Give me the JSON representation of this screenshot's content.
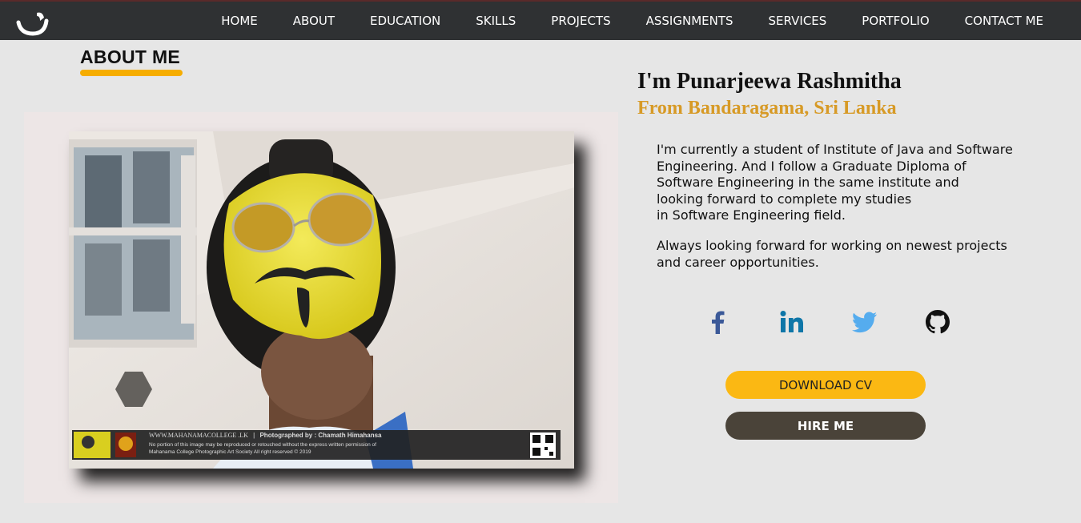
{
  "nav": {
    "items": [
      "HOME",
      "ABOUT",
      "EDUCATION",
      "SKILLS",
      "PROJECTS",
      "ASSIGNMENTS",
      "SERVICES",
      "PORTFOLIO",
      "CONTACT ME"
    ]
  },
  "about": {
    "section_title": "ABOUT ME",
    "name": "I'm Punarjeewa Rashmitha",
    "location": "From Bandaragama, Sri Lanka",
    "bio_paragraph_1_lines": [
      "I'm currently a student of Institute of Java and Software",
      "Engineering. And I follow a Graduate Diploma of",
      "Software Engineering in the same institute and",
      "looking forward to complete my studies",
      "in Software Engineering field."
    ],
    "bio_paragraph_2_lines": [
      "Always looking forward for working on newest projects",
      "and career opportunities."
    ],
    "download_cv_label": "DOWNLOAD CV",
    "hire_me_label": "HIRE ME"
  },
  "photo": {
    "watermark_site": "WWW.MAHANAMACOLLEGE .LK",
    "watermark_credit": "Photographed by : Chamath Himahansa",
    "watermark_notice_1": "No portion of this image may be reproduced or retouched without the express written permission of",
    "watermark_notice_2": "Mahanama College Photographic Art Society All right reserved © 2019"
  },
  "social": {
    "icons": [
      "facebook-icon",
      "linkedin-icon",
      "twitter-icon",
      "github-icon"
    ]
  },
  "colors": {
    "navbar": "#2f3133",
    "accent_yellow": "#f6ad00",
    "location_gold": "#d79a26",
    "hire_button": "#4a4339",
    "facebook": "#3b5998",
    "linkedin": "#0e76a8",
    "twitter": "#55acee"
  }
}
